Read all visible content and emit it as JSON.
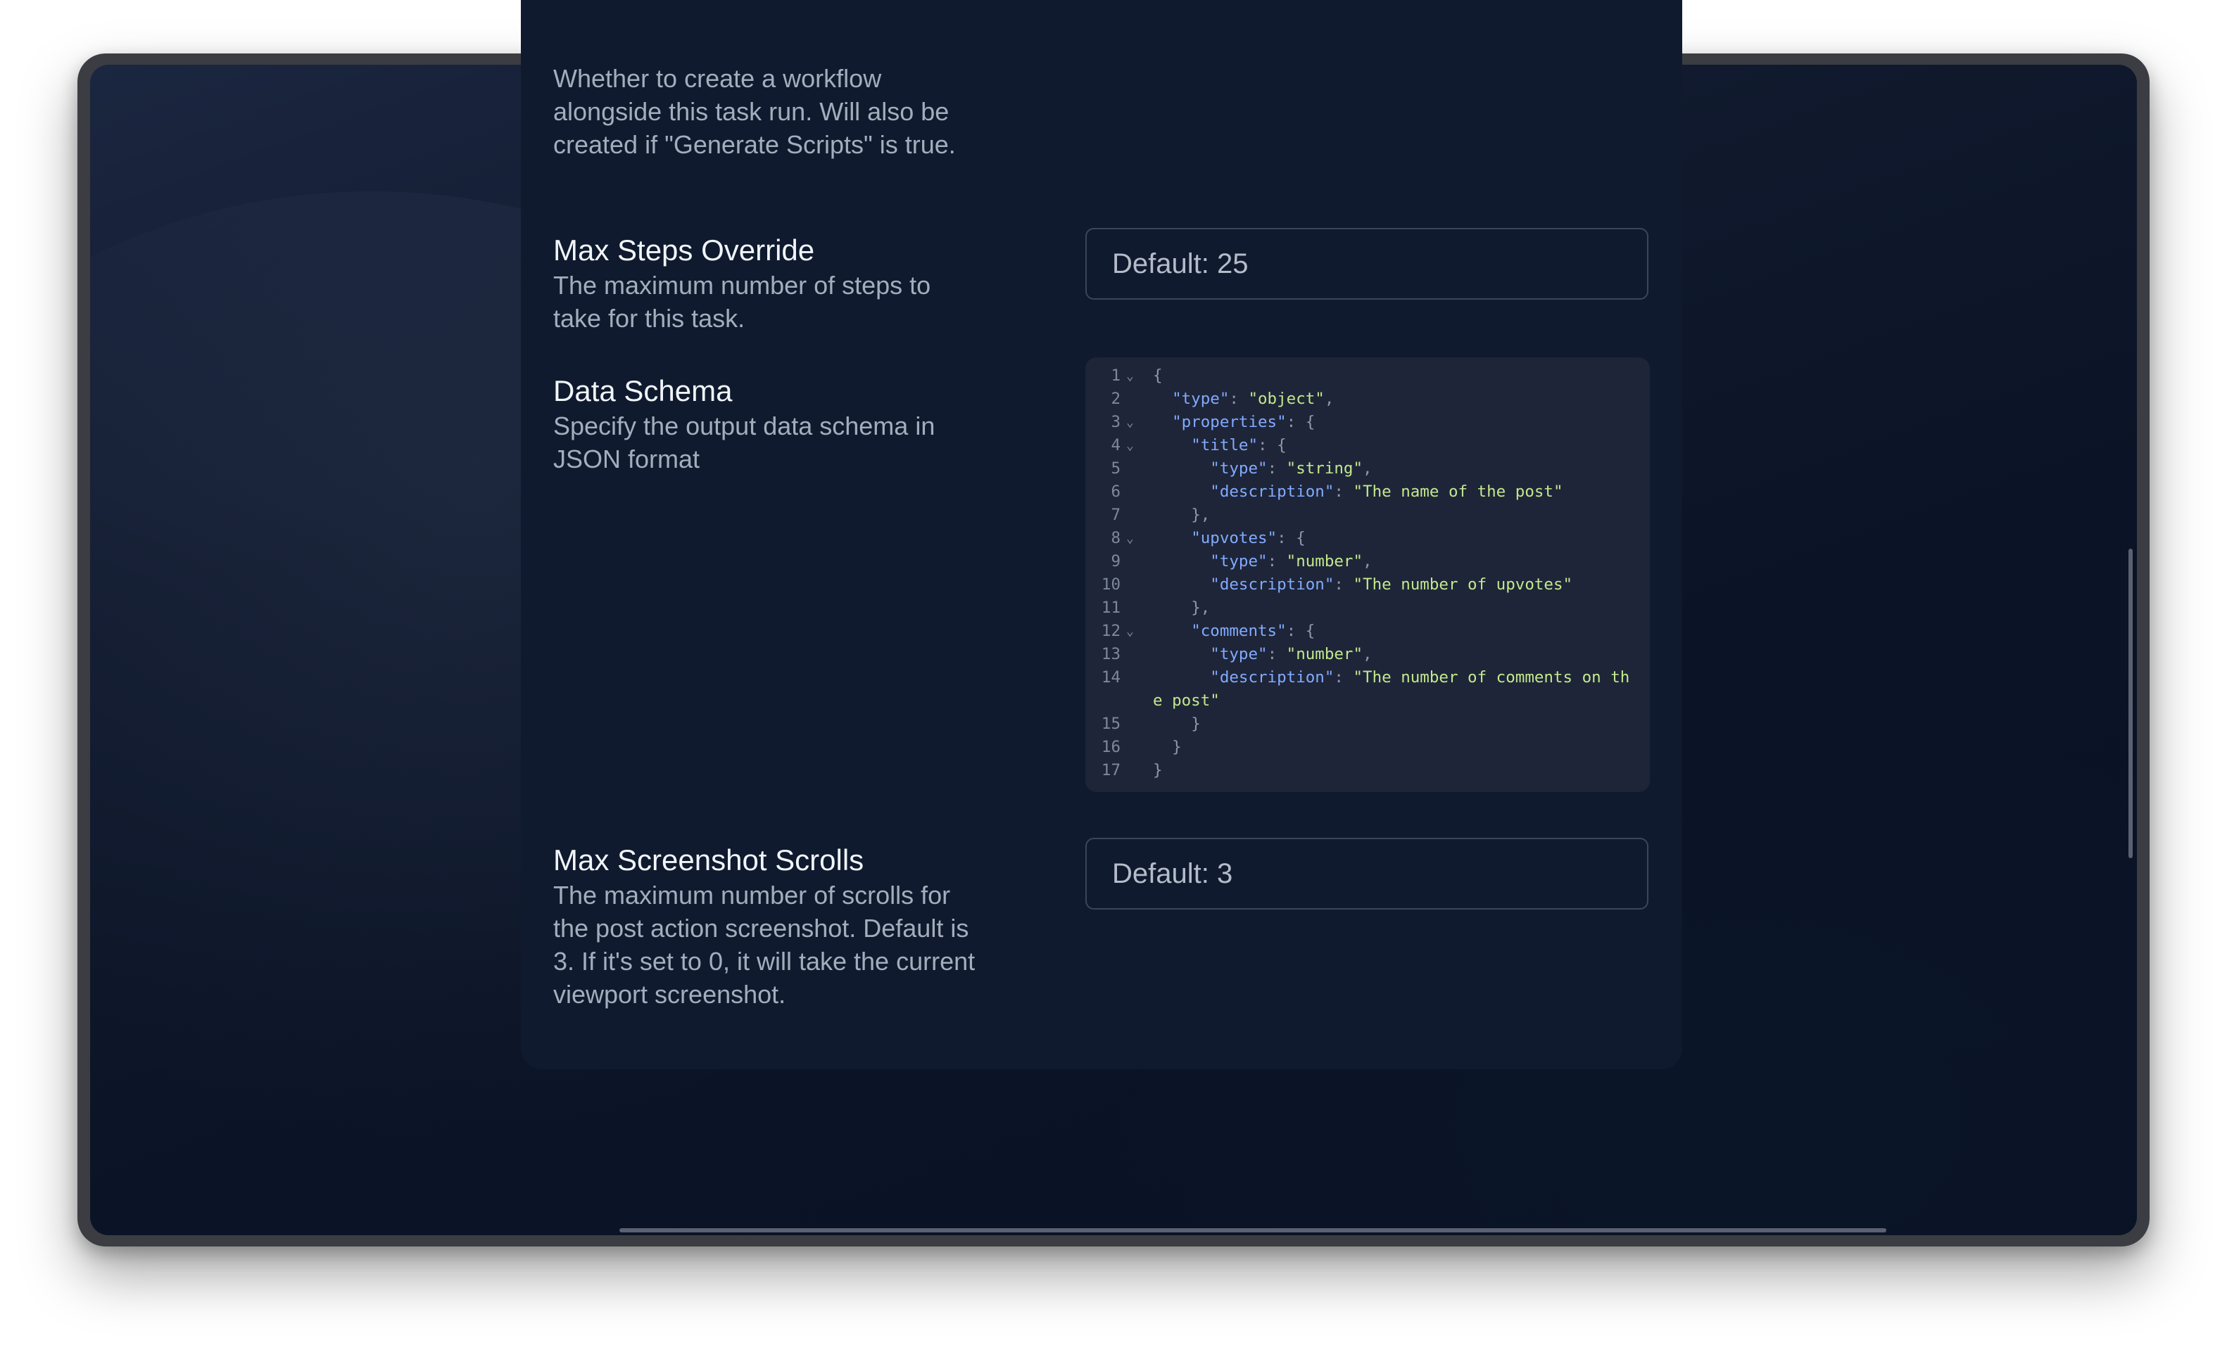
{
  "sections": {
    "workflow_desc": "Whether to create a workflow alongside this task run. Will also be created if \"Generate Scripts\" is true.",
    "max_steps": {
      "title": "Max Steps Override",
      "description": "The maximum number of steps to take for this task.",
      "placeholder": "Default: 25"
    },
    "data_schema": {
      "title": "Data Schema",
      "description": "Specify the output data schema in JSON format"
    },
    "max_scrolls": {
      "title": "Max Screenshot Scrolls",
      "description": "The maximum number of scrolls for the post action screenshot. Default is 3. If it's set to 0, it will take the current viewport screenshot.",
      "placeholder": "Default: 3"
    }
  },
  "code_editor": {
    "lines": [
      {
        "n": "1",
        "fold": true,
        "indent": "",
        "key": "",
        "sep": "{",
        "val": "",
        "tail": ""
      },
      {
        "n": "2",
        "fold": false,
        "indent": "  ",
        "key": "\"type\"",
        "sep": ": ",
        "val": "\"object\"",
        "tail": ","
      },
      {
        "n": "3",
        "fold": true,
        "indent": "  ",
        "key": "\"properties\"",
        "sep": ": {",
        "val": "",
        "tail": ""
      },
      {
        "n": "4",
        "fold": true,
        "indent": "    ",
        "key": "\"title\"",
        "sep": ": {",
        "val": "",
        "tail": ""
      },
      {
        "n": "5",
        "fold": false,
        "indent": "      ",
        "key": "\"type\"",
        "sep": ": ",
        "val": "\"string\"",
        "tail": ","
      },
      {
        "n": "6",
        "fold": false,
        "indent": "      ",
        "key": "\"description\"",
        "sep": ": ",
        "val": "\"The name of the post\"",
        "tail": ""
      },
      {
        "n": "7",
        "fold": false,
        "indent": "    ",
        "key": "",
        "sep": "},",
        "val": "",
        "tail": ""
      },
      {
        "n": "8",
        "fold": true,
        "indent": "    ",
        "key": "\"upvotes\"",
        "sep": ": {",
        "val": "",
        "tail": ""
      },
      {
        "n": "9",
        "fold": false,
        "indent": "      ",
        "key": "\"type\"",
        "sep": ": ",
        "val": "\"number\"",
        "tail": ","
      },
      {
        "n": "10",
        "fold": false,
        "indent": "      ",
        "key": "\"description\"",
        "sep": ": ",
        "val": "\"The number of upvotes\"",
        "tail": ""
      },
      {
        "n": "11",
        "fold": false,
        "indent": "    ",
        "key": "",
        "sep": "},",
        "val": "",
        "tail": ""
      },
      {
        "n": "12",
        "fold": true,
        "indent": "    ",
        "key": "\"comments\"",
        "sep": ": {",
        "val": "",
        "tail": ""
      },
      {
        "n": "13",
        "fold": false,
        "indent": "      ",
        "key": "\"type\"",
        "sep": ": ",
        "val": "\"number\"",
        "tail": ","
      },
      {
        "n": "14",
        "fold": false,
        "indent": "      ",
        "key": "\"description\"",
        "sep": ": ",
        "val": "\"The number of comments on the post\"",
        "tail": "",
        "wrap": true
      },
      {
        "n": "15",
        "fold": false,
        "indent": "    ",
        "key": "",
        "sep": "}",
        "val": "",
        "tail": ""
      },
      {
        "n": "16",
        "fold": false,
        "indent": "  ",
        "key": "",
        "sep": "}",
        "val": "",
        "tail": ""
      },
      {
        "n": "17",
        "fold": false,
        "indent": "",
        "key": "",
        "sep": "}",
        "val": "",
        "tail": ""
      }
    ]
  }
}
